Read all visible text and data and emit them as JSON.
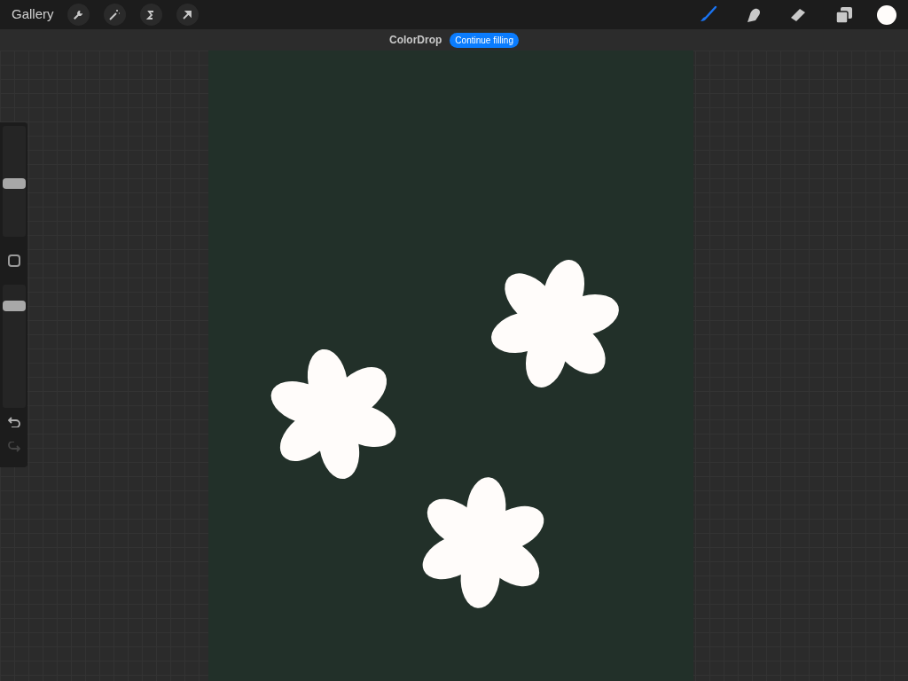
{
  "top_bar": {
    "gallery": "Gallery",
    "actions": [
      {
        "kind": "wrench"
      },
      {
        "kind": "wand"
      },
      {
        "kind": "selection"
      },
      {
        "kind": "transform"
      }
    ],
    "tools": [
      {
        "kind": "brush",
        "selected": true
      },
      {
        "kind": "smudge",
        "selected": false
      },
      {
        "kind": "eraser",
        "selected": false
      },
      {
        "kind": "layers",
        "selected": false
      }
    ]
  },
  "status": {
    "title": "ColorDrop",
    "action": "Continue filling"
  },
  "sidebar": {
    "size_slider": {
      "level": 0.48
    },
    "opacity_slider": {
      "level": 0.86
    },
    "undo": {
      "disabled": false
    },
    "redo": {
      "disabled": true
    }
  }
}
